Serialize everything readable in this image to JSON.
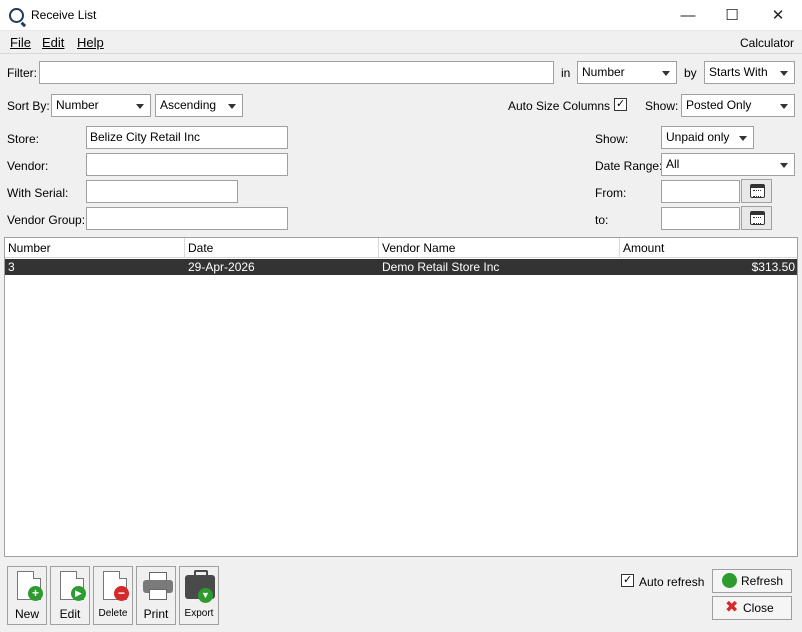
{
  "window": {
    "title": "Receive List",
    "minimize": "—",
    "maximize": "☐",
    "close": "✕"
  },
  "menu": {
    "file": "File",
    "edit": "Edit",
    "help": "Help",
    "calculator": "Calculator"
  },
  "filter": {
    "label": "Filter:",
    "value": "",
    "in_label": "in",
    "in_value": "Number",
    "by_label": "by",
    "by_value": "Starts With"
  },
  "sort": {
    "label": "Sort By:",
    "field": "Number",
    "order": "Ascending",
    "auto_size_label": "Auto Size Columns",
    "auto_size_checked": true,
    "show_label": "Show:",
    "show_value": "Posted Only"
  },
  "fields": {
    "store_label": "Store:",
    "store_value": "Belize City Retail Inc",
    "vendor_label": "Vendor:",
    "vendor_value": "",
    "serial_label": "With Serial:",
    "serial_value": "",
    "vendor_group_label": "Vendor Group:",
    "vendor_group_value": ""
  },
  "right_filters": {
    "show_label": "Show:",
    "show_value": "Unpaid only",
    "date_range_label": "Date Range:",
    "date_range_value": "All",
    "from_label": "From:",
    "from_value": "",
    "to_label": "to:",
    "to_value": ""
  },
  "table": {
    "columns": [
      "Number",
      "Date",
      "Vendor Name",
      "Amount"
    ],
    "rows": [
      {
        "number": "3",
        "date": "29-Apr-2026",
        "vendor": "Demo Retail Store Inc",
        "amount": "$313.50",
        "selected": true
      }
    ]
  },
  "toolbar": {
    "new": "New",
    "edit": "Edit",
    "delete": "Delete",
    "print": "Print",
    "export": "Export"
  },
  "footer": {
    "auto_refresh_label": "Auto refresh",
    "auto_refresh_checked": true,
    "refresh": "Refresh",
    "close": "Close"
  },
  "icons": {
    "new": "plus-icon",
    "edit": "arrow-right-icon",
    "delete": "minus-icon",
    "print": "printer-icon",
    "export": "briefcase-icon",
    "refresh": "refresh-icon",
    "close": "x-icon",
    "calendar": "calendar-icon"
  },
  "colors": {
    "selected_row": "#333333",
    "green": "#2e9b2e",
    "red": "#d42a2a"
  }
}
